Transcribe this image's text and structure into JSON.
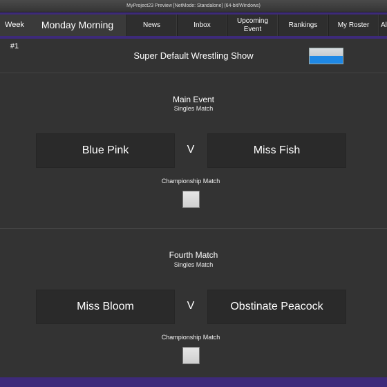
{
  "window": {
    "title": "MyProject23 Preview [NetMode: Standalone]  (64-bit/Windows)"
  },
  "topbar": {
    "week": "Week #1",
    "time_of_day": "Monday Morning",
    "nav": [
      "News",
      "Inbox",
      "Upcoming Event",
      "Rankings",
      "My Roster",
      "All"
    ]
  },
  "show": {
    "title": "Super Default Wrestling Show"
  },
  "matches": [
    {
      "title": "Main Event",
      "type": "Singles Match",
      "wrestler1": "Blue Pink",
      "vs": "V",
      "wrestler2": "Miss Fish",
      "championship_label": "Championship Match",
      "championship_checked": false
    },
    {
      "title": "Fourth Match",
      "type": "Singles Match",
      "wrestler1": "Miss Bloom",
      "vs": "V",
      "wrestler2": "Obstinate Peacock",
      "championship_label": "Championship Match",
      "championship_checked": false
    }
  ],
  "colors": {
    "accent": "#3d2a7a",
    "background": "#333333",
    "card": "#2a2a2a",
    "flag_blue": "#1e88e5"
  }
}
